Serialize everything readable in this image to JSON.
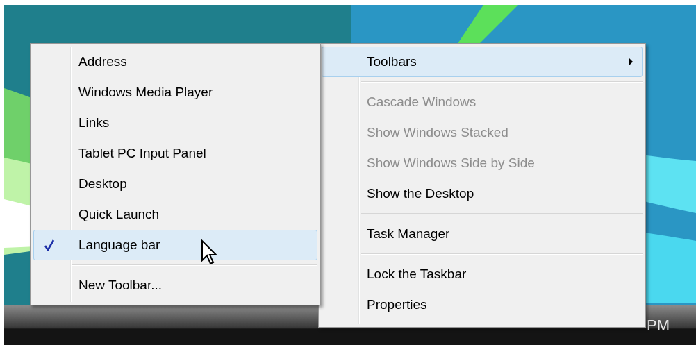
{
  "toolbars_submenu": {
    "sections": [
      {
        "items": [
          {
            "label": "Address",
            "checked": false,
            "selected": false
          },
          {
            "label": "Windows Media Player",
            "checked": false,
            "selected": false
          },
          {
            "label": "Links",
            "checked": false,
            "selected": false
          },
          {
            "label": "Tablet PC Input Panel",
            "checked": false,
            "selected": false
          },
          {
            "label": "Desktop",
            "checked": false,
            "selected": false
          },
          {
            "label": "Quick Launch",
            "checked": false,
            "selected": false
          },
          {
            "label": "Language bar",
            "checked": true,
            "selected": true
          }
        ]
      },
      {
        "items": [
          {
            "label": "New Toolbar...",
            "checked": false,
            "selected": false
          }
        ]
      }
    ]
  },
  "taskbar_menu": {
    "sections": [
      {
        "items": [
          {
            "label": "Toolbars",
            "kind": "submenu",
            "selected": true,
            "disabled": false
          }
        ]
      },
      {
        "items": [
          {
            "label": "Cascade Windows",
            "kind": "command",
            "selected": false,
            "disabled": true
          },
          {
            "label": "Show Windows Stacked",
            "kind": "command",
            "selected": false,
            "disabled": true
          },
          {
            "label": "Show Windows Side by Side",
            "kind": "command",
            "selected": false,
            "disabled": true
          },
          {
            "label": "Show the Desktop",
            "kind": "command",
            "selected": false,
            "disabled": false
          }
        ]
      },
      {
        "items": [
          {
            "label": "Task Manager",
            "kind": "command",
            "selected": false,
            "disabled": false
          }
        ]
      },
      {
        "items": [
          {
            "label": "Lock the Taskbar",
            "kind": "command",
            "selected": false,
            "disabled": false
          },
          {
            "label": "Properties",
            "kind": "command",
            "selected": false,
            "disabled": false
          }
        ]
      }
    ]
  },
  "taskbar": {
    "clock": "PM"
  }
}
